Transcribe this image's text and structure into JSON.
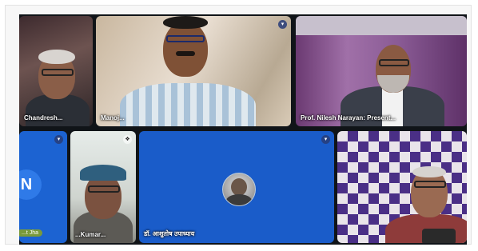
{
  "meeting": {
    "participants": [
      {
        "id": "t1",
        "name": "Chandresh..."
      },
      {
        "id": "t2",
        "name": "Manoj..."
      },
      {
        "id": "t3",
        "name": "Prof. Nilesh Narayan: Present..."
      },
      {
        "id": "t4",
        "name": "...t Jha",
        "initial": "N"
      },
      {
        "id": "t5",
        "name": "...Kumar..."
      },
      {
        "id": "t6",
        "name": "डॉ. आशुतोष उपाध्याय"
      },
      {
        "id": "t7",
        "name": ""
      }
    ]
  },
  "icons": {
    "mic": "microphone-muted-icon",
    "pin": "pin-icon"
  },
  "colors": {
    "tile_blue": "#1a5cc9",
    "background": "#101418"
  }
}
